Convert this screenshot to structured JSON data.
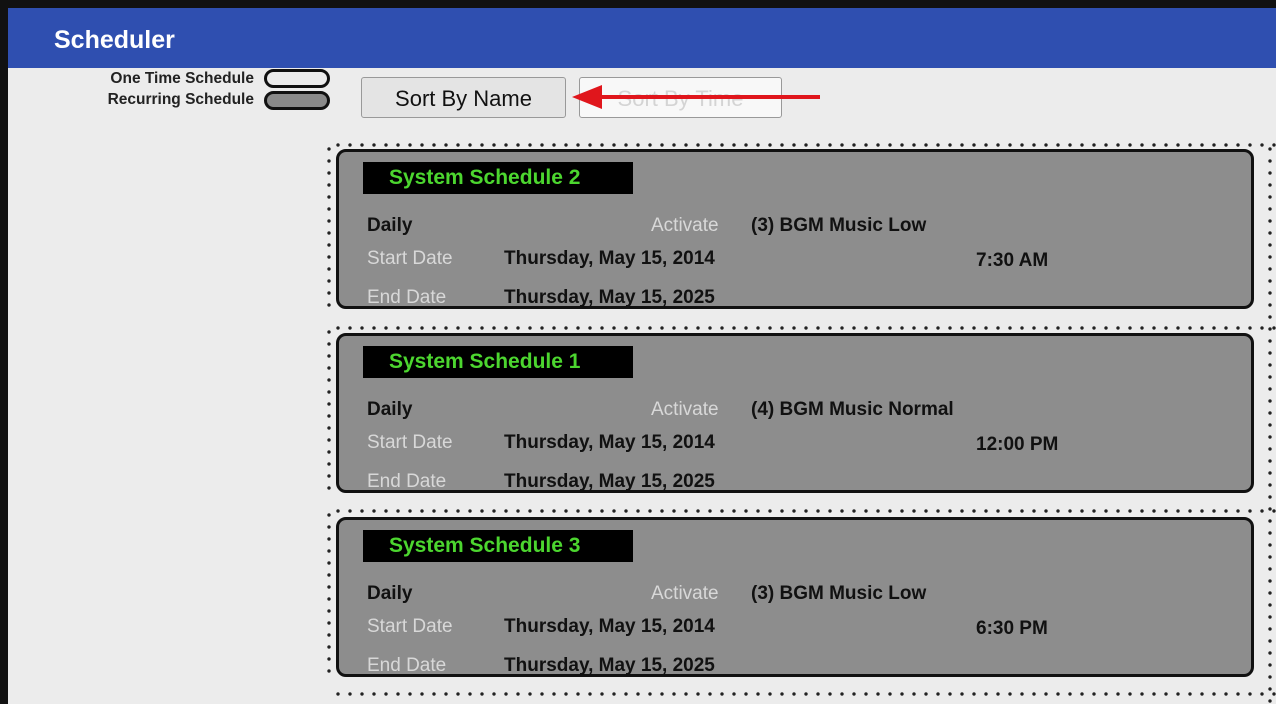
{
  "app": {
    "title": "Scheduler"
  },
  "legend": {
    "one_time": "One Time Schedule",
    "recurring": "Recurring Schedule"
  },
  "toolbar": {
    "sort_by_name": "Sort By Name",
    "sort_by_time": "Sort By Time"
  },
  "labels": {
    "activate": "Activate",
    "start_date": "Start Date",
    "end_date": "End Date"
  },
  "schedules": [
    {
      "name": "System Schedule 2",
      "recurrence": "Daily",
      "activate": "(3) BGM Music Low",
      "start_date": "Thursday, May 15, 2014",
      "time": "7:30 AM",
      "end_date": "Thursday, May 15, 2025"
    },
    {
      "name": "System Schedule 1",
      "recurrence": "Daily",
      "activate": "(4) BGM Music Normal",
      "start_date": "Thursday, May 15, 2014",
      "time": "12:00 PM",
      "end_date": "Thursday, May 15, 2025"
    },
    {
      "name": "System Schedule 3",
      "recurrence": "Daily",
      "activate": "(3) BGM Music Low",
      "start_date": "Thursday, May 15, 2014",
      "time": "6:30 PM",
      "end_date": "Thursday, May 15, 2025"
    }
  ],
  "colors": {
    "titlebar": "#2f4fb0",
    "card_bg": "#8d8d8d",
    "card_title_text": "#4cd62f",
    "arrow": "#e0161c"
  }
}
